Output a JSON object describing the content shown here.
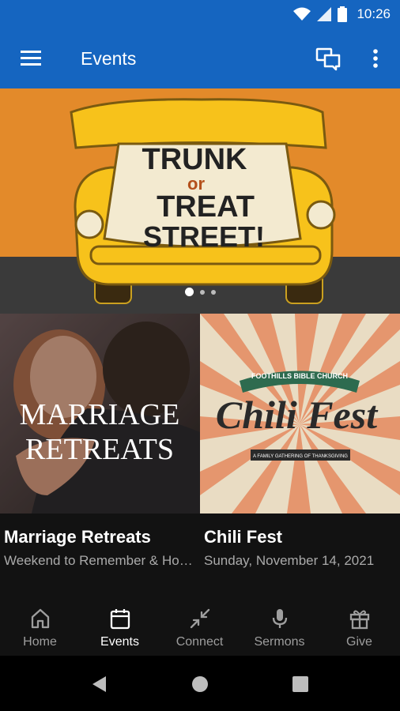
{
  "status": {
    "time": "10:26"
  },
  "app_bar": {
    "title": "Events"
  },
  "hero": {
    "line1": "TRUNK",
    "line2": "or",
    "line3": "TREAT",
    "line4": "STREET!",
    "page_count": 3,
    "active_page": 1
  },
  "events": [
    {
      "title": "Marriage Retreats",
      "subtitle": "Weekend to Remember & Homebuilders",
      "image_text_1": "MARRIAGE",
      "image_text_2": "RETREATS"
    },
    {
      "title": "Chili Fest",
      "subtitle": "Sunday, November 14, 2021",
      "image_header": "FOOTHILLS BIBLE CHURCH",
      "image_title": "Chili Fest",
      "image_tagline": "A FAMILY GATHERING OF THANKSGIVING"
    }
  ],
  "nav": {
    "items": [
      {
        "label": "Home",
        "icon": "home-icon"
      },
      {
        "label": "Events",
        "icon": "calendar-icon"
      },
      {
        "label": "Connect",
        "icon": "connect-icon"
      },
      {
        "label": "Sermons",
        "icon": "microphone-icon"
      },
      {
        "label": "Give",
        "icon": "gift-icon"
      }
    ],
    "active": "Events"
  },
  "colors": {
    "primary": "#1565c0",
    "hero_bg": "#e38a2a",
    "car_yellow": "#f7c21b",
    "background": "#121212"
  }
}
